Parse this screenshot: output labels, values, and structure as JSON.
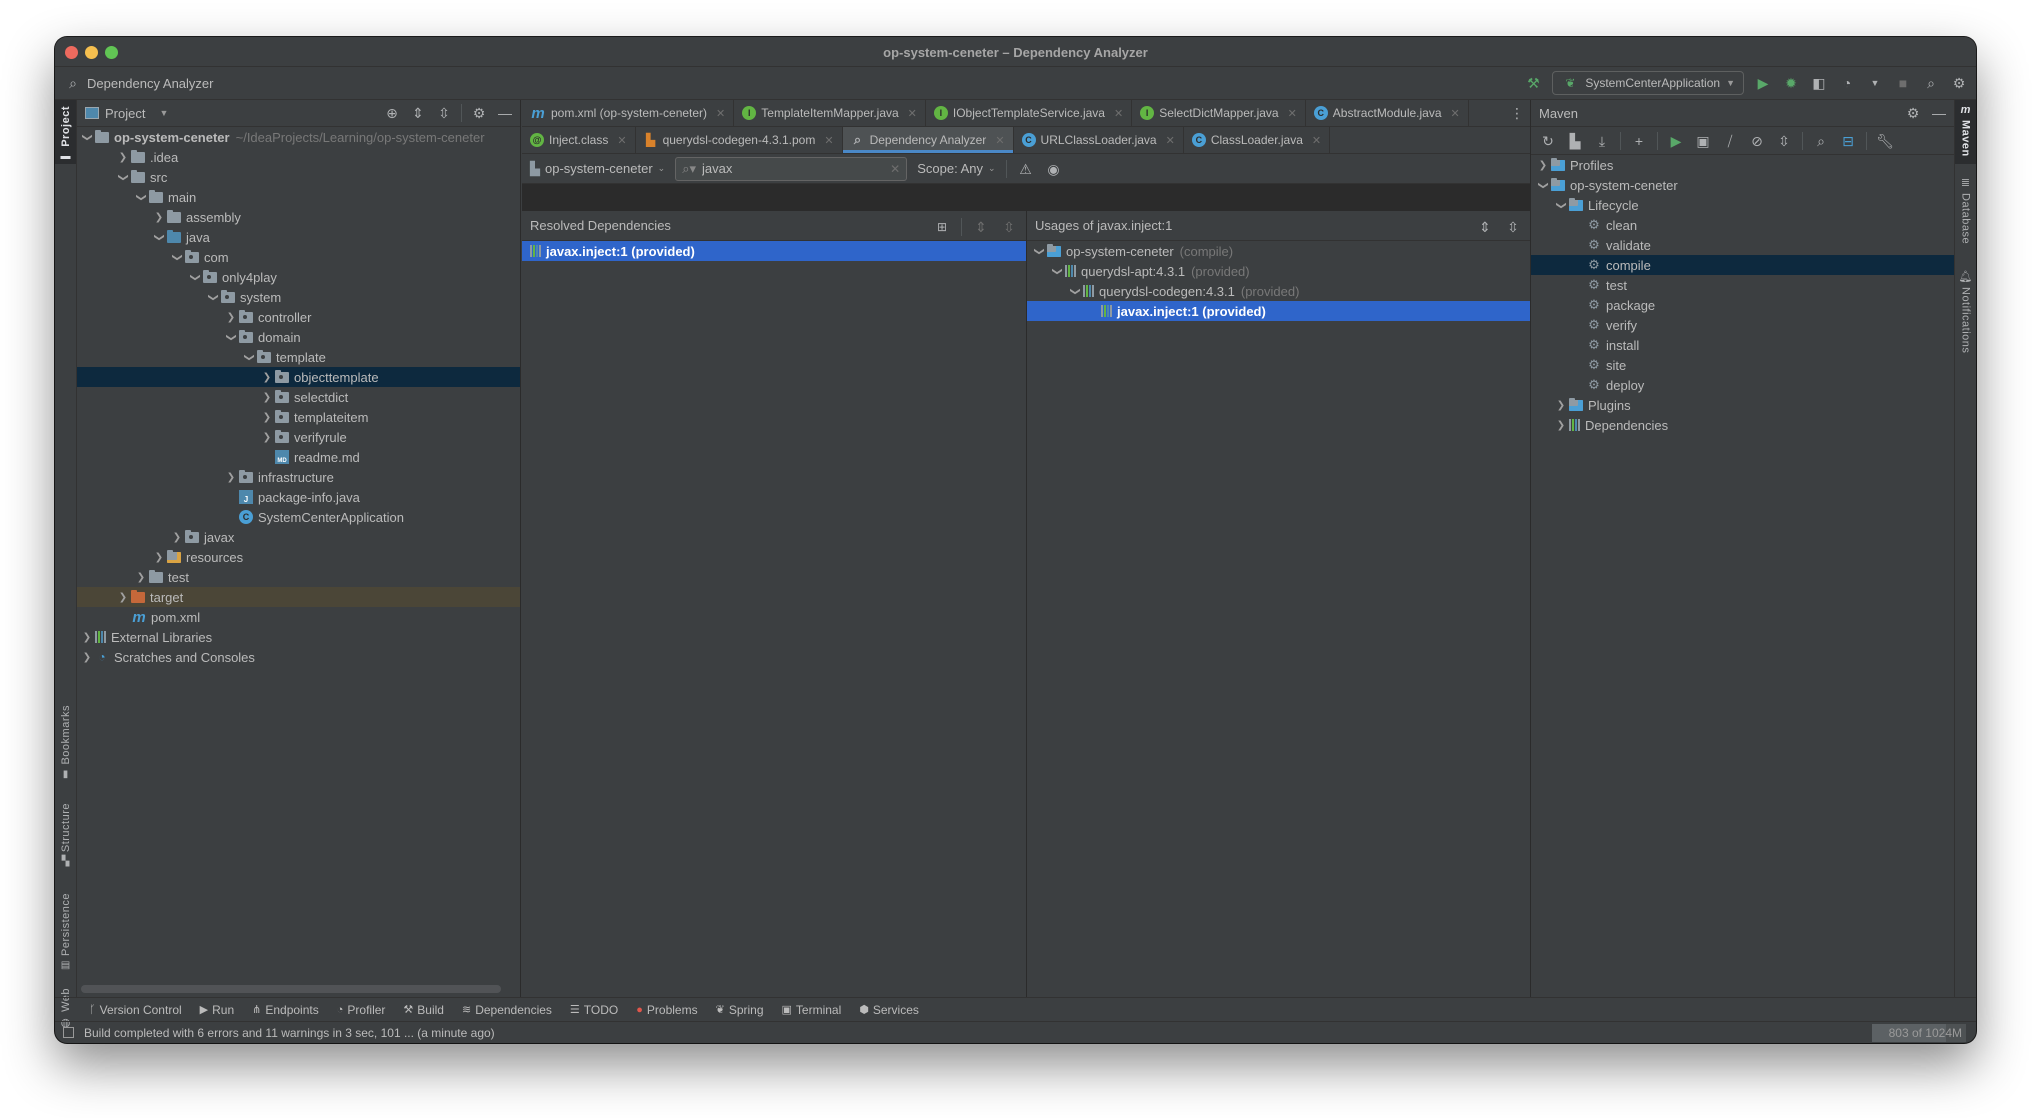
{
  "window": {
    "title": "op-system-ceneter – Dependency Analyzer"
  },
  "navbar": {
    "crumb": "Dependency Analyzer",
    "run_config": "SystemCenterApplication"
  },
  "left_stripe": {
    "top": [
      "Project"
    ],
    "bottom": [
      "Bookmarks",
      "Structure",
      "Persistence",
      "Web"
    ]
  },
  "right_stripe": [
    "Maven",
    "Database",
    "Notifications"
  ],
  "project": {
    "title": "Project",
    "root_name": "op-system-ceneter",
    "root_path": "~/IdeaProjects/Learning/op-system-ceneter",
    "items": [
      {
        "label": ".idea",
        "depth": 1,
        "chev": "right",
        "icon": "folder"
      },
      {
        "label": "src",
        "depth": 1,
        "chev": "down",
        "icon": "folder"
      },
      {
        "label": "main",
        "depth": 2,
        "chev": "down",
        "icon": "folder"
      },
      {
        "label": "assembly",
        "depth": 3,
        "chev": "right",
        "icon": "folder"
      },
      {
        "label": "java",
        "depth": 3,
        "chev": "down",
        "icon": "src-folder"
      },
      {
        "label": "com",
        "depth": 4,
        "chev": "down",
        "icon": "package"
      },
      {
        "label": "only4play",
        "depth": 5,
        "chev": "down",
        "icon": "package"
      },
      {
        "label": "system",
        "depth": 6,
        "chev": "down",
        "icon": "package"
      },
      {
        "label": "controller",
        "depth": 7,
        "chev": "right",
        "icon": "package"
      },
      {
        "label": "domain",
        "depth": 7,
        "chev": "down",
        "icon": "package"
      },
      {
        "label": "template",
        "depth": 8,
        "chev": "down",
        "icon": "package"
      },
      {
        "label": "objecttemplate",
        "depth": 9,
        "chev": "right",
        "icon": "package",
        "state": "selected"
      },
      {
        "label": "selectdict",
        "depth": 9,
        "chev": "right",
        "icon": "package"
      },
      {
        "label": "templateitem",
        "depth": 9,
        "chev": "right",
        "icon": "package"
      },
      {
        "label": "verifyrule",
        "depth": 9,
        "chev": "right",
        "icon": "package"
      },
      {
        "label": "readme.md",
        "depth": 9,
        "chev": "none",
        "icon": "markdown"
      },
      {
        "label": "infrastructure",
        "depth": 7,
        "chev": "right",
        "icon": "package"
      },
      {
        "label": "package-info.java",
        "depth": 7,
        "chev": "none",
        "icon": "java-file"
      },
      {
        "label": "SystemCenterApplication",
        "depth": 7,
        "chev": "none",
        "icon": "spring-app"
      },
      {
        "label": "javax",
        "depth": 4,
        "chev": "right",
        "icon": "package"
      },
      {
        "label": "resources",
        "depth": 3,
        "chev": "right",
        "icon": "resources-folder"
      },
      {
        "label": "test",
        "depth": 2,
        "chev": "right",
        "icon": "folder"
      },
      {
        "label": "target",
        "depth": 1,
        "chev": "right",
        "icon": "excluded-folder",
        "state": "excluded"
      },
      {
        "label": "pom.xml",
        "depth": 1,
        "chev": "none",
        "icon": "maven-file"
      },
      {
        "label": "External Libraries",
        "depth": 0,
        "chev": "right",
        "icon": "libraries"
      },
      {
        "label": "Scratches and Consoles",
        "depth": 0,
        "chev": "right",
        "icon": "scratches"
      }
    ]
  },
  "tabs": {
    "row1": [
      {
        "label": "pom.xml (op-system-ceneter)",
        "icon": "m"
      },
      {
        "label": "TemplateItemMapper.java",
        "icon": "i"
      },
      {
        "label": "IObjectTemplateService.java",
        "icon": "i"
      },
      {
        "label": "SelectDictMapper.java",
        "icon": "i"
      },
      {
        "label": "AbstractModule.java",
        "icon": "c"
      }
    ],
    "row2": [
      {
        "label": "Inject.class",
        "icon": "a"
      },
      {
        "label": "querydsl-codegen-4.3.1.pom",
        "icon": "pom"
      },
      {
        "label": "Dependency Analyzer",
        "icon": "da",
        "active": true
      },
      {
        "label": "URLClassLoader.java",
        "icon": "c"
      },
      {
        "label": "ClassLoader.java",
        "icon": "c"
      }
    ]
  },
  "analyzer": {
    "module": "op-system-ceneter",
    "search_value": "javax",
    "scope_label": "Scope: Any",
    "resolved_header": "Resolved Dependencies",
    "resolved": [
      {
        "label": "javax.inject:1 (provided)",
        "selected": true
      }
    ],
    "usages_header": "Usages of javax.inject:1",
    "usages": [
      {
        "name": "op-system-ceneter",
        "scope": "(compile)",
        "depth": 0,
        "icon": "module"
      },
      {
        "name": "querydsl-apt:4.3.1",
        "scope": "(provided)",
        "depth": 1,
        "icon": "library"
      },
      {
        "name": "querydsl-codegen:4.3.1",
        "scope": "(provided)",
        "depth": 2,
        "icon": "library"
      },
      {
        "name": "javax.inject:1 (provided)",
        "scope": "",
        "depth": 3,
        "icon": "library",
        "selected": true
      }
    ]
  },
  "maven": {
    "title": "Maven",
    "tree": [
      {
        "label": "Profiles",
        "depth": 0,
        "chev": "right",
        "icon": "profiles"
      },
      {
        "label": "op-system-ceneter",
        "depth": 0,
        "chev": "down",
        "icon": "maven-module"
      },
      {
        "label": "Lifecycle",
        "depth": 1,
        "chev": "down",
        "icon": "lifecycle"
      },
      {
        "label": "clean",
        "depth": 2,
        "chev": "none",
        "icon": "gear"
      },
      {
        "label": "validate",
        "depth": 2,
        "chev": "none",
        "icon": "gear"
      },
      {
        "label": "compile",
        "depth": 2,
        "chev": "none",
        "icon": "gear",
        "state": "selected"
      },
      {
        "label": "test",
        "depth": 2,
        "chev": "none",
        "icon": "gear"
      },
      {
        "label": "package",
        "depth": 2,
        "chev": "none",
        "icon": "gear"
      },
      {
        "label": "verify",
        "depth": 2,
        "chev": "none",
        "icon": "gear"
      },
      {
        "label": "install",
        "depth": 2,
        "chev": "none",
        "icon": "gear"
      },
      {
        "label": "site",
        "depth": 2,
        "chev": "none",
        "icon": "gear"
      },
      {
        "label": "deploy",
        "depth": 2,
        "chev": "none",
        "icon": "gear"
      },
      {
        "label": "Plugins",
        "depth": 1,
        "chev": "right",
        "icon": "plugins"
      },
      {
        "label": "Dependencies",
        "depth": 1,
        "chev": "right",
        "icon": "dependencies"
      }
    ]
  },
  "toolwindows": [
    "Version Control",
    "Run",
    "Endpoints",
    "Profiler",
    "Build",
    "Dependencies",
    "TODO",
    "Problems",
    "Spring",
    "Terminal",
    "Services"
  ],
  "status": {
    "message": "Build completed with 6 errors and 11 warnings in 3 sec, 101 ... (a minute ago)",
    "memory_label": "803 of 1024M",
    "memory_used_mb": 803,
    "memory_total_mb": 1024
  },
  "colors": {
    "selection_blue": "#2f65ca",
    "selection_inactive": "#0d293e",
    "excluded_bg": "#4b4637",
    "accent_tab": "#4a88c7",
    "run_green": "#59a869"
  }
}
